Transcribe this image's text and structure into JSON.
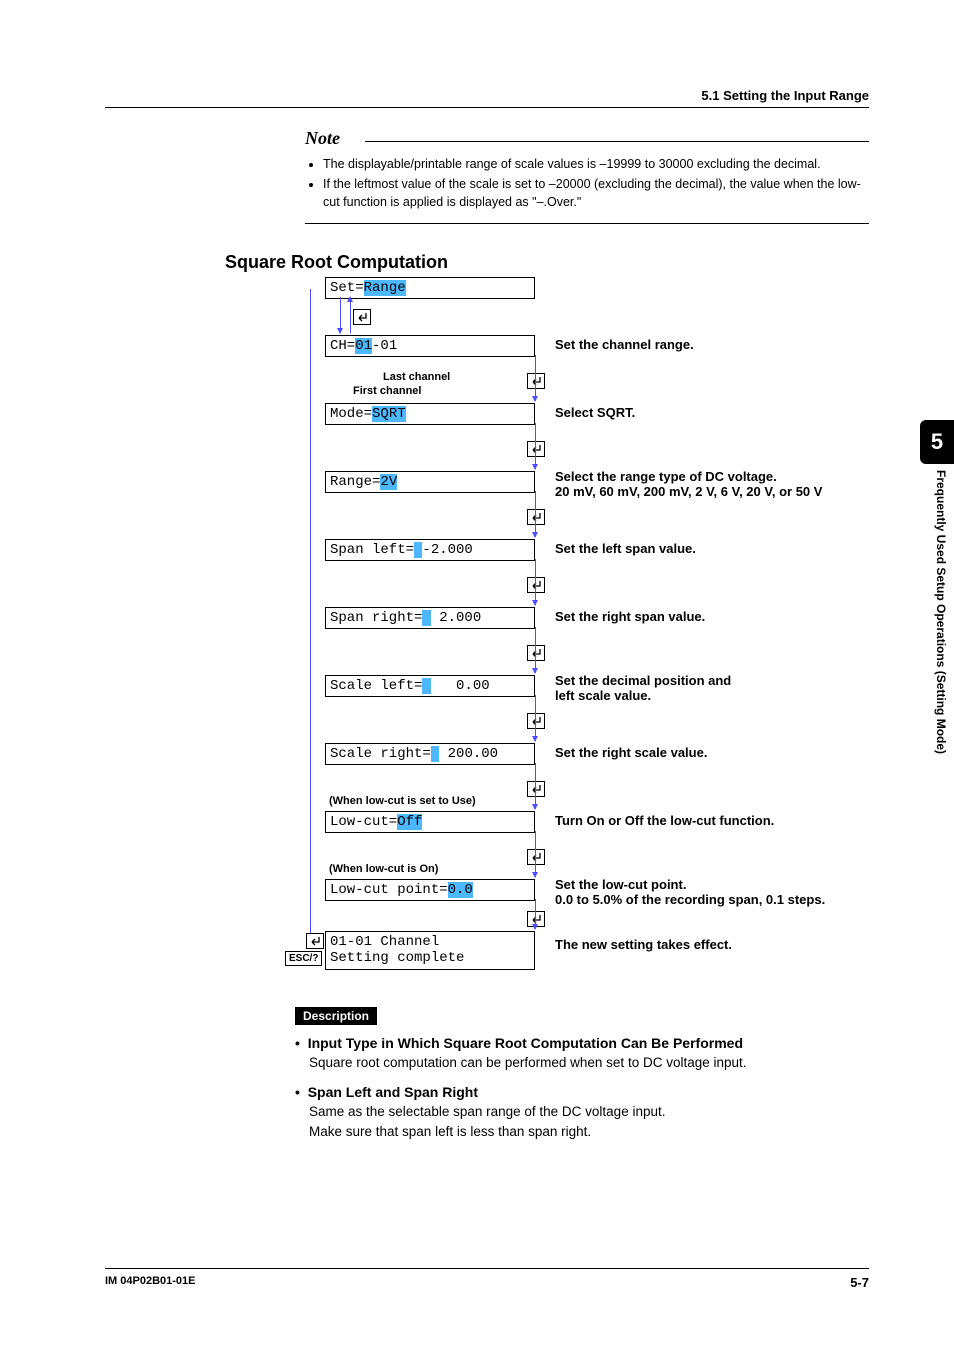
{
  "header": {
    "section": "5.1  Setting the Input Range"
  },
  "note": {
    "title": "Note",
    "items": [
      "The displayable/printable range of scale values is –19999 to 30000 excluding the decimal.",
      "If the leftmost value of the scale is set to –20000 (excluding the decimal), the value when the low-cut function is applied is displayed as \"–.Over.\""
    ]
  },
  "section_heading": "Square Root Computation",
  "flow": {
    "set_prefix": "Set=",
    "set_value": "Range",
    "ch_prefix": "CH=",
    "ch_hl": "01",
    "ch_suffix": "-01",
    "ch_desc": "Set the channel range.",
    "ch_last": "Last channel",
    "ch_first": "First channel",
    "mode_prefix": "Mode=",
    "mode_value": "SQRT",
    "mode_desc": "Select SQRT.",
    "range_prefix": "Range=",
    "range_value": "2V",
    "range_desc1": "Select the range type of DC voltage.",
    "range_desc2": "20 mV, 60 mV, 200 mV, 2 V, 6 V, 20 V, or 50 V",
    "spanl_prefix": "Span left=",
    "spanl_value": "-2.000",
    "spanl_desc": "Set the left span value.",
    "spanr_prefix": "Span right=",
    "spanr_value": " 2.000",
    "spanr_desc": "Set the right span value.",
    "scalel_prefix": "Scale left=",
    "scalel_value": "   0.00",
    "scalel_desc1": "Set the decimal position and",
    "scalel_desc2": "left scale value.",
    "scaler_prefix": "Scale right=",
    "scaler_value": " 200.00",
    "scaler_desc": "Set the right scale value.",
    "lowcut_note": "(When low-cut is set to Use)",
    "lowcut_prefix": "Low-cut=",
    "lowcut_value": "Off",
    "lowcut_desc": "Turn On or Off the low-cut function.",
    "lowcutp_note": "(When low-cut is On)",
    "lowcutp_prefix": "Low-cut point=",
    "lowcutp_value": "0.0",
    "lowcutp_desc1": "Set the low-cut point.",
    "lowcutp_desc2": "0.0 to 5.0% of the recording span, 0.1 steps.",
    "final_line1": "01-01 Channel",
    "final_line2": "Setting complete",
    "final_desc": "The new setting takes effect.",
    "esc": "ESC/?"
  },
  "description": {
    "label": "Description",
    "items": [
      {
        "title": "Input Type in Which Square Root Computation Can Be Performed",
        "body": "Square root computation can be performed when set to DC voltage input."
      },
      {
        "title": "Span Left and Span Right",
        "body": "Same as the selectable span range of the DC voltage input.\nMake sure that span left is less than span right."
      }
    ]
  },
  "sidebar": {
    "chapter": "5",
    "label": "Frequently Used Setup Operations (Setting Mode)"
  },
  "footer": {
    "doc": "IM 04P02B01-01E",
    "page": "5-7"
  }
}
